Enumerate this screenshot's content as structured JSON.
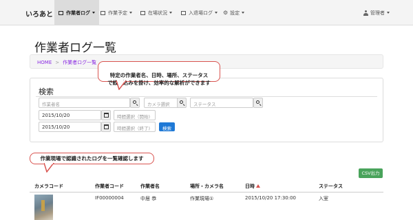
{
  "navbar": {
    "brand": "いろあと",
    "items": [
      {
        "label": "作業者ログ",
        "icon": "grid-icon",
        "active": true
      },
      {
        "label": "作業予定",
        "icon": "list-icon",
        "active": false
      },
      {
        "label": "在場状況",
        "icon": "table-icon",
        "active": false
      },
      {
        "label": "入退場ログ",
        "icon": "table-icon",
        "active": false
      },
      {
        "label": "設定",
        "icon": "gear-icon",
        "active": false
      }
    ],
    "user": "管理者"
  },
  "page": {
    "title": "作業者ログ一覧",
    "breadcrumb": [
      "HOME",
      "作業者ログ一覧"
    ],
    "breadcrumb_separator": ">"
  },
  "callouts": {
    "search": "特定の作業者名、日時、場所、ステータス\nで絞り込みを掛け、効率的な解析ができます",
    "list": "作業現場で認識されたログを一覧確認します"
  },
  "search": {
    "title": "検索",
    "worker_placeholder": "作業者名",
    "camera_placeholder": "カメラ選択",
    "status_placeholder": "ステータス",
    "start_date": "2015/10/20",
    "start_time_placeholder": "時間選択（開始)",
    "end_date": "2015/10/20",
    "end_time_placeholder": "時間選択（終了)",
    "submit_label": "検索"
  },
  "list": {
    "csv_label": "CSV出力",
    "columns": [
      "カメラコード",
      "作業者コード",
      "作業者名",
      "場所・カメラ名",
      "日時",
      "ステータス"
    ],
    "rows": [
      {
        "worker_code": "IF00000004",
        "worker_name": "中居 恭",
        "location": "作業現場①",
        "datetime": "2015/10/20 17:30:00",
        "status": "入室"
      }
    ]
  },
  "colors": {
    "accent": "#1f79d6",
    "csv": "#49a35b",
    "callout_border": "#d9534f",
    "breadcrumb_link": "#8a2be2"
  }
}
